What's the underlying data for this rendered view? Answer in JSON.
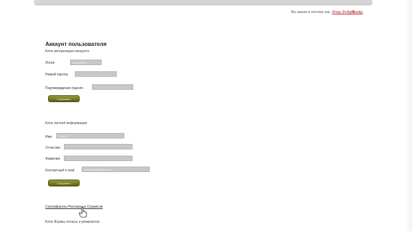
{
  "header": {
    "user_prefix": "Вы зашли в систему как,",
    "user_link": "Игорь (fruitgirl)",
    "logout": "Выход"
  },
  "main": {
    "title": "Аккаунт пользователя",
    "auth_block_title": "Блок авторизации аккаунта",
    "auth_fields": [
      {
        "label": "Логин",
        "value": "fuxtan2006"
      },
      {
        "label": "Новый пароль",
        "value": ""
      },
      {
        "label": "Подтверждение пароля",
        "value": ""
      }
    ],
    "save_label_1": "Сохранить",
    "personal_block_title": "Блок личной информации",
    "personal_fields": [
      {
        "label": "Имя",
        "value": "Игорь"
      },
      {
        "label": "Отчество",
        "value": ""
      },
      {
        "label": "Фамилия",
        "value": ""
      },
      {
        "label": "Контактный e-mail",
        "value": "fuxtan2006@yandex.ru"
      }
    ],
    "save_label_2": "Сохранить",
    "certificates_link": "Сертификаты Рекламных Сервисов",
    "payment_block_title": "Блок Формы оплаты и реквизитов"
  }
}
